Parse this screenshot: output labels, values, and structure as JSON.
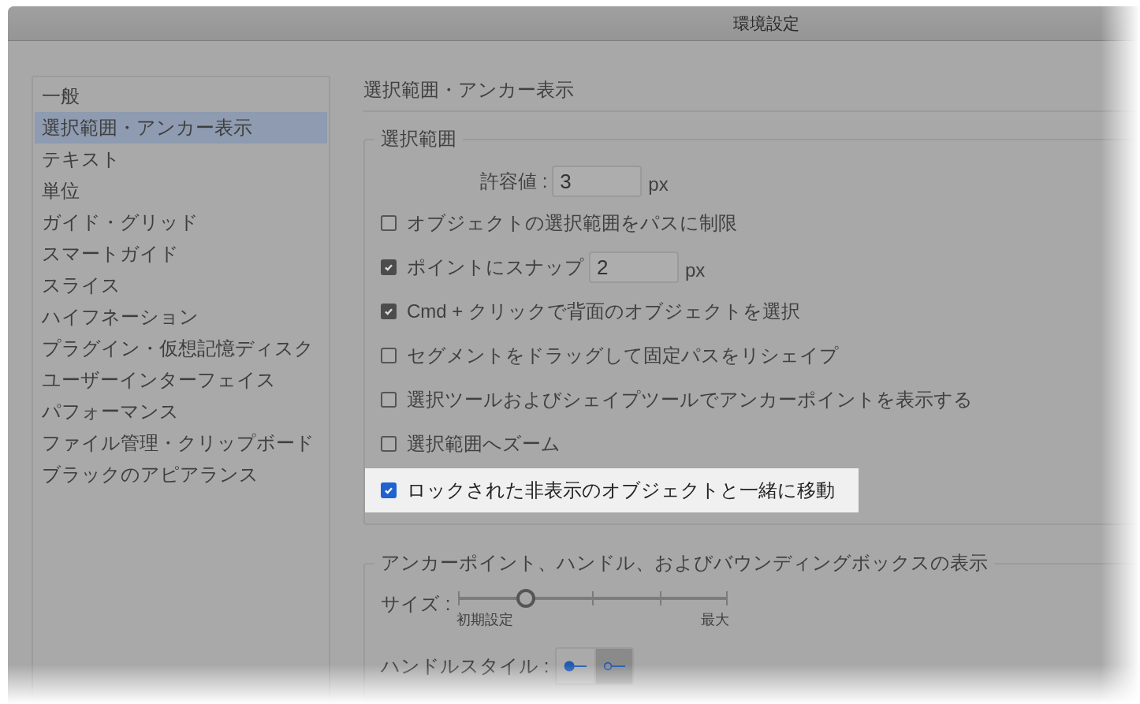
{
  "window": {
    "title": "環境設定"
  },
  "sidebar": {
    "items": [
      {
        "label": "一般",
        "selected": false
      },
      {
        "label": "選択範囲・アンカー表示",
        "selected": true
      },
      {
        "label": "テキスト",
        "selected": false
      },
      {
        "label": "単位",
        "selected": false
      },
      {
        "label": "ガイド・グリッド",
        "selected": false
      },
      {
        "label": "スマートガイド",
        "selected": false
      },
      {
        "label": "スライス",
        "selected": false
      },
      {
        "label": "ハイフネーション",
        "selected": false
      },
      {
        "label": "プラグイン・仮想記憶ディスク",
        "selected": false
      },
      {
        "label": "ユーザーインターフェイス",
        "selected": false
      },
      {
        "label": "パフォーマンス",
        "selected": false
      },
      {
        "label": "ファイル管理・クリップボード",
        "selected": false
      },
      {
        "label": "ブラックのアピアランス",
        "selected": false
      }
    ]
  },
  "panel": {
    "title": "選択範囲・アンカー表示",
    "selection_group": {
      "legend": "選択範囲",
      "tolerance": {
        "label": "許容値 :",
        "value": "3",
        "unit": "px"
      },
      "options": [
        {
          "kind": "checkbox",
          "label": "オブジェクトの選択範囲をパスに制限",
          "checked": false,
          "highlighted": false
        },
        {
          "kind": "checkbox-field",
          "label": "ポイントにスナップ",
          "checked": true,
          "highlighted": false,
          "value": "2",
          "unit": "px"
        },
        {
          "kind": "checkbox",
          "label": "Cmd + クリックで背面のオブジェクトを選択",
          "checked": true,
          "highlighted": false
        },
        {
          "kind": "checkbox",
          "label": "セグメントをドラッグして固定パスをリシェイプ",
          "checked": false,
          "highlighted": false
        },
        {
          "kind": "checkbox",
          "label": "選択ツールおよびシェイプツールでアンカーポイントを表示する",
          "checked": false,
          "highlighted": false
        },
        {
          "kind": "checkbox",
          "label": "選択範囲へズーム",
          "checked": false,
          "highlighted": false
        },
        {
          "kind": "checkbox",
          "label": "ロックされた非表示のオブジェクトと一緒に移動",
          "checked": true,
          "highlighted": true
        }
      ]
    },
    "anchor_group": {
      "legend": "アンカーポイント、ハンドル、およびバウンディングボックスの表示",
      "size": {
        "label": "サイズ :",
        "level": 0.25,
        "min_label": "初期設定",
        "max_label": "最大"
      },
      "handle_style": {
        "label": "ハンドルスタイル :",
        "options": [
          {
            "kind": "filled",
            "selected": false
          },
          {
            "kind": "hollow",
            "selected": true
          }
        ]
      }
    }
  }
}
